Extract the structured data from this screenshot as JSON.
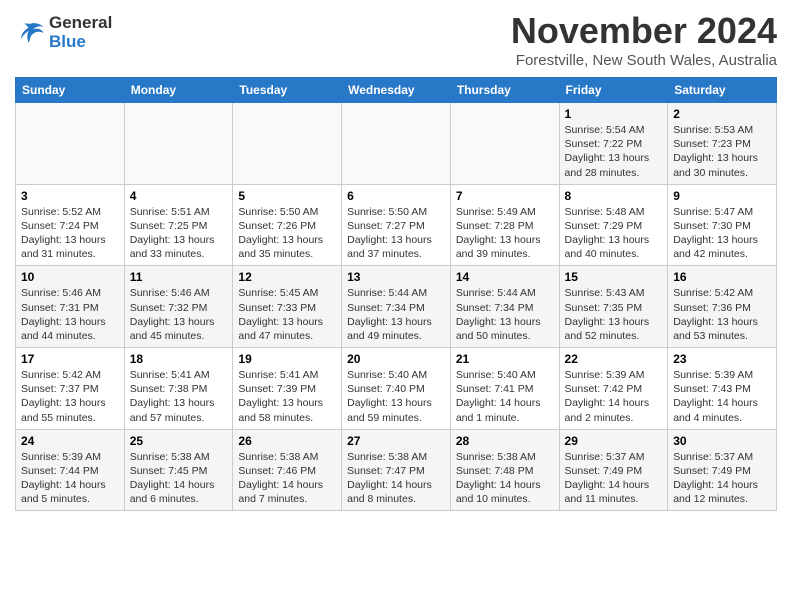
{
  "header": {
    "logo_line1": "General",
    "logo_line2": "Blue",
    "month": "November 2024",
    "location": "Forestville, New South Wales, Australia"
  },
  "days_of_week": [
    "Sunday",
    "Monday",
    "Tuesday",
    "Wednesday",
    "Thursday",
    "Friday",
    "Saturday"
  ],
  "weeks": [
    [
      {
        "day": "",
        "info": ""
      },
      {
        "day": "",
        "info": ""
      },
      {
        "day": "",
        "info": ""
      },
      {
        "day": "",
        "info": ""
      },
      {
        "day": "",
        "info": ""
      },
      {
        "day": "1",
        "info": "Sunrise: 5:54 AM\nSunset: 7:22 PM\nDaylight: 13 hours and 28 minutes."
      },
      {
        "day": "2",
        "info": "Sunrise: 5:53 AM\nSunset: 7:23 PM\nDaylight: 13 hours and 30 minutes."
      }
    ],
    [
      {
        "day": "3",
        "info": "Sunrise: 5:52 AM\nSunset: 7:24 PM\nDaylight: 13 hours and 31 minutes."
      },
      {
        "day": "4",
        "info": "Sunrise: 5:51 AM\nSunset: 7:25 PM\nDaylight: 13 hours and 33 minutes."
      },
      {
        "day": "5",
        "info": "Sunrise: 5:50 AM\nSunset: 7:26 PM\nDaylight: 13 hours and 35 minutes."
      },
      {
        "day": "6",
        "info": "Sunrise: 5:50 AM\nSunset: 7:27 PM\nDaylight: 13 hours and 37 minutes."
      },
      {
        "day": "7",
        "info": "Sunrise: 5:49 AM\nSunset: 7:28 PM\nDaylight: 13 hours and 39 minutes."
      },
      {
        "day": "8",
        "info": "Sunrise: 5:48 AM\nSunset: 7:29 PM\nDaylight: 13 hours and 40 minutes."
      },
      {
        "day": "9",
        "info": "Sunrise: 5:47 AM\nSunset: 7:30 PM\nDaylight: 13 hours and 42 minutes."
      }
    ],
    [
      {
        "day": "10",
        "info": "Sunrise: 5:46 AM\nSunset: 7:31 PM\nDaylight: 13 hours and 44 minutes."
      },
      {
        "day": "11",
        "info": "Sunrise: 5:46 AM\nSunset: 7:32 PM\nDaylight: 13 hours and 45 minutes."
      },
      {
        "day": "12",
        "info": "Sunrise: 5:45 AM\nSunset: 7:33 PM\nDaylight: 13 hours and 47 minutes."
      },
      {
        "day": "13",
        "info": "Sunrise: 5:44 AM\nSunset: 7:34 PM\nDaylight: 13 hours and 49 minutes."
      },
      {
        "day": "14",
        "info": "Sunrise: 5:44 AM\nSunset: 7:34 PM\nDaylight: 13 hours and 50 minutes."
      },
      {
        "day": "15",
        "info": "Sunrise: 5:43 AM\nSunset: 7:35 PM\nDaylight: 13 hours and 52 minutes."
      },
      {
        "day": "16",
        "info": "Sunrise: 5:42 AM\nSunset: 7:36 PM\nDaylight: 13 hours and 53 minutes."
      }
    ],
    [
      {
        "day": "17",
        "info": "Sunrise: 5:42 AM\nSunset: 7:37 PM\nDaylight: 13 hours and 55 minutes."
      },
      {
        "day": "18",
        "info": "Sunrise: 5:41 AM\nSunset: 7:38 PM\nDaylight: 13 hours and 57 minutes."
      },
      {
        "day": "19",
        "info": "Sunrise: 5:41 AM\nSunset: 7:39 PM\nDaylight: 13 hours and 58 minutes."
      },
      {
        "day": "20",
        "info": "Sunrise: 5:40 AM\nSunset: 7:40 PM\nDaylight: 13 hours and 59 minutes."
      },
      {
        "day": "21",
        "info": "Sunrise: 5:40 AM\nSunset: 7:41 PM\nDaylight: 14 hours and 1 minute."
      },
      {
        "day": "22",
        "info": "Sunrise: 5:39 AM\nSunset: 7:42 PM\nDaylight: 14 hours and 2 minutes."
      },
      {
        "day": "23",
        "info": "Sunrise: 5:39 AM\nSunset: 7:43 PM\nDaylight: 14 hours and 4 minutes."
      }
    ],
    [
      {
        "day": "24",
        "info": "Sunrise: 5:39 AM\nSunset: 7:44 PM\nDaylight: 14 hours and 5 minutes."
      },
      {
        "day": "25",
        "info": "Sunrise: 5:38 AM\nSunset: 7:45 PM\nDaylight: 14 hours and 6 minutes."
      },
      {
        "day": "26",
        "info": "Sunrise: 5:38 AM\nSunset: 7:46 PM\nDaylight: 14 hours and 7 minutes."
      },
      {
        "day": "27",
        "info": "Sunrise: 5:38 AM\nSunset: 7:47 PM\nDaylight: 14 hours and 8 minutes."
      },
      {
        "day": "28",
        "info": "Sunrise: 5:38 AM\nSunset: 7:48 PM\nDaylight: 14 hours and 10 minutes."
      },
      {
        "day": "29",
        "info": "Sunrise: 5:37 AM\nSunset: 7:49 PM\nDaylight: 14 hours and 11 minutes."
      },
      {
        "day": "30",
        "info": "Sunrise: 5:37 AM\nSunset: 7:49 PM\nDaylight: 14 hours and 12 minutes."
      }
    ]
  ]
}
